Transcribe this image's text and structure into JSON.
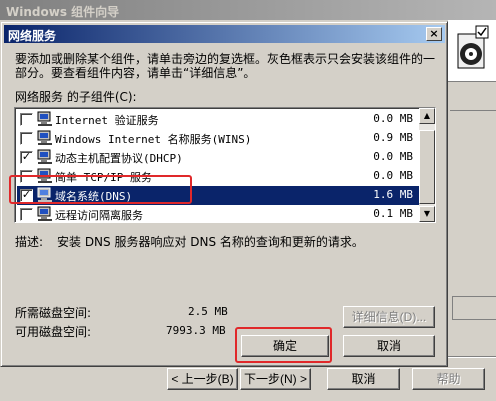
{
  "wizard": {
    "title": "Windows 组件向导",
    "buttons": {
      "back": "< 上一步(B)",
      "next": "下一步(N) >",
      "cancel": "取消",
      "help": "帮助"
    }
  },
  "dialog": {
    "title": "网络服务",
    "close_glyph": "×",
    "intro_line1": "要添加或删除某个组件，请单击旁边的复选框。灰色框表示只会安装该组件的一",
    "intro_line2": "部分。要查看组件内容，请单击“详细信息”。",
    "subcomponents_label": "网络服务 的子组件(C):",
    "components": [
      {
        "name": "Internet 验证服务",
        "size": "0.0 MB",
        "checked": false,
        "selected": false
      },
      {
        "name": "Windows Internet 名称服务(WINS)",
        "size": "0.9 MB",
        "checked": false,
        "selected": false
      },
      {
        "name": "动态主机配置协议(DHCP)",
        "size": "0.0 MB",
        "checked": true,
        "selected": false
      },
      {
        "name": "简单 TCP/IP 服务",
        "size": "0.0 MB",
        "checked": false,
        "selected": false
      },
      {
        "name": "域名系统(DNS)",
        "size": "1.6 MB",
        "checked": true,
        "selected": true
      },
      {
        "name": "远程访问隔离服务",
        "size": "0.1 MB",
        "checked": false,
        "selected": false
      }
    ],
    "description_label": "描述:",
    "description_text": "安装 DNS 服务器响应对 DNS 名称的查询和更新的请求。",
    "disk_required_label": "所需磁盘空间:",
    "disk_required_value": "2.5 MB",
    "disk_available_label": "可用磁盘空间:",
    "disk_available_value": "7993.3 MB",
    "details_button": "详细信息(D)...",
    "ok_button": "确定",
    "cancel_button": "取消"
  },
  "colors": {
    "highlight": "#e0282a",
    "selection": "#0a246a",
    "title_active": "#0a246a"
  }
}
